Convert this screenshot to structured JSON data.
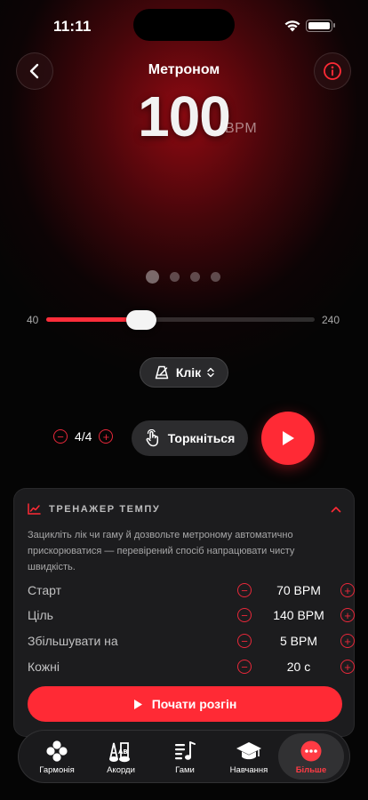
{
  "status_bar": {
    "time": "11:11"
  },
  "header": {
    "title": "Метроном"
  },
  "tempo": {
    "value": "100",
    "unit": "BPM"
  },
  "pages": {
    "count": 4,
    "active": 0
  },
  "slider": {
    "min_label": "40",
    "max_label": "240",
    "min": 40,
    "max": 240,
    "value": 100
  },
  "sound": {
    "label": "Клік"
  },
  "controls": {
    "time_signature": "4/4",
    "tap_label": "Торкніться"
  },
  "trainer": {
    "title": "ТРЕНАЖЕР ТЕМПУ",
    "description": "Зацикліть лік чи гаму й дозвольте метроному автоматично прискорюватися — перевірений спосіб напрацювати чисту швидкість.",
    "rows": [
      {
        "label": "Старт",
        "value": "70 BPM"
      },
      {
        "label": "Ціль",
        "value": "140 BPM"
      },
      {
        "label": "Збільшувати на",
        "value": "5 BPM"
      },
      {
        "label": "Кожні",
        "value": "20 с"
      }
    ],
    "start_button": "Почати розгін"
  },
  "tabs": [
    {
      "label": "Гармонія",
      "icon": "harmony-icon"
    },
    {
      "label": "Акорди",
      "icon": "chords-icon"
    },
    {
      "label": "Гами",
      "icon": "scales-icon"
    },
    {
      "label": "Навчання",
      "icon": "learning-icon"
    },
    {
      "label": "Більше",
      "icon": "more-icon",
      "active": true
    }
  ],
  "colors": {
    "accent": "#ff2a35",
    "background": "#050505",
    "card": "#1c1c1e"
  }
}
